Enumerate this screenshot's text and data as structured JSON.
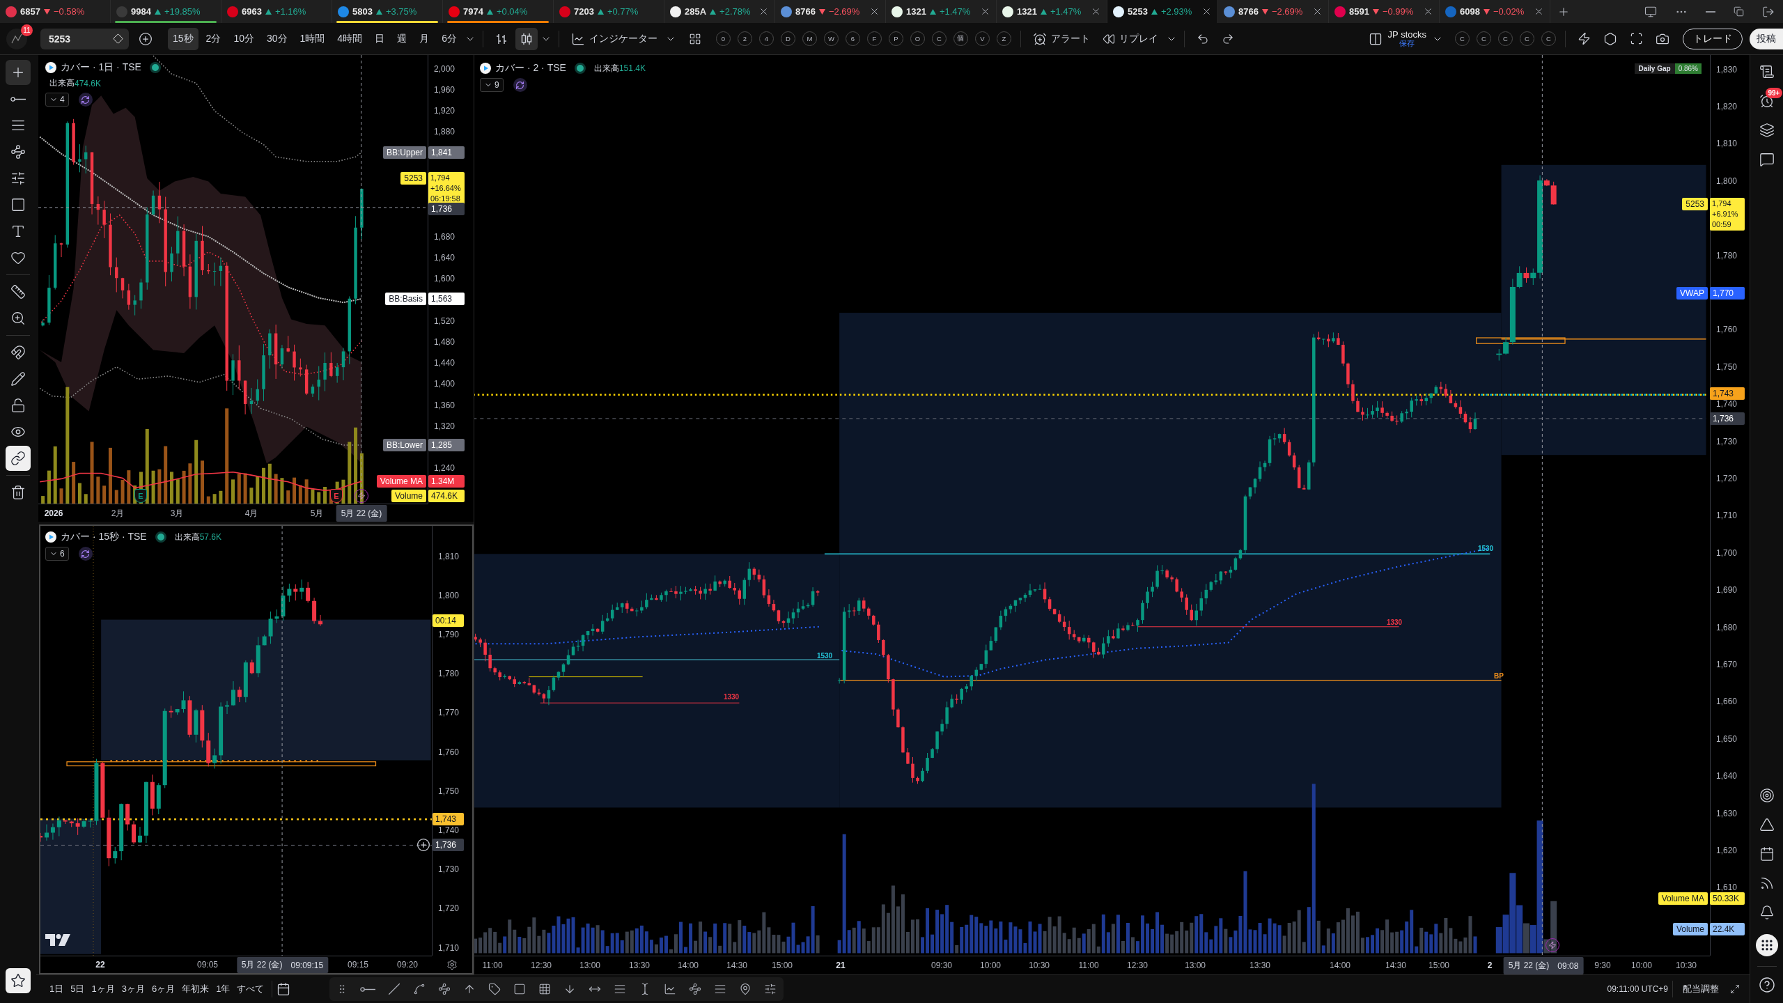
{
  "tabs": [
    {
      "symbol": "6857",
      "change": "−0.58%",
      "rising": false,
      "color": "#e0314b",
      "selected": false,
      "closable": false
    },
    {
      "symbol": "9984",
      "change": "+19.85%",
      "rising": true,
      "color": "#3a3a3a",
      "underline": {
        "color": "#4caf50"
      },
      "selected": false,
      "closable": false
    },
    {
      "symbol": "6963",
      "change": "+1.16%",
      "rising": true,
      "color": "#d7001a",
      "selected": false,
      "closable": false
    },
    {
      "symbol": "5803",
      "change": "+3.75%",
      "rising": true,
      "color": "#1e88e5",
      "underline": {
        "color": "#fdd835"
      },
      "selected": false,
      "closable": false
    },
    {
      "symbol": "7974",
      "change": "+0.04%",
      "rising": true,
      "color": "#e60012",
      "underline": {
        "color": "#f57c00"
      },
      "selected": false,
      "closable": false
    },
    {
      "symbol": "7203",
      "change": "+0.77%",
      "rising": true,
      "color": "#d7001a",
      "selected": false,
      "closable": false
    },
    {
      "symbol": "285A",
      "change": "+2.78%",
      "rising": true,
      "color": "#f2f2f2",
      "selected": false,
      "closable": true
    },
    {
      "symbol": "8766",
      "change": "−2.69%",
      "rising": false,
      "color": "#5b8fd6",
      "selected": false,
      "closable": true
    },
    {
      "symbol": "1321",
      "change": "+1.47%",
      "rising": true,
      "color": "#e8f5e9",
      "selected": false,
      "closable": true
    },
    {
      "symbol": "1321",
      "change": "+1.47%",
      "rising": true,
      "color": "#e8f5e9",
      "selected": false,
      "closable": true
    },
    {
      "symbol": "5253",
      "change": "+2.93%",
      "rising": true,
      "color": "#e3f2fd",
      "selected": true,
      "closable": true
    },
    {
      "symbol": "8766",
      "change": "−2.69%",
      "rising": false,
      "color": "#5b8fd6",
      "selected": false,
      "closable": true
    },
    {
      "symbol": "8591",
      "change": "−0.99%",
      "rising": false,
      "color": "#e0004d",
      "selected": false,
      "closable": true
    },
    {
      "symbol": "6098",
      "change": "−0.02%",
      "rising": false,
      "color": "#1565c0",
      "selected": false,
      "closable": true
    }
  ],
  "toolbar": {
    "notifications": "11",
    "symbol": "5253",
    "intervals": [
      {
        "label": "15秒",
        "selected": true
      },
      {
        "label": "2分",
        "selected": false
      },
      {
        "label": "10分",
        "selected": false
      },
      {
        "label": "30分",
        "selected": false
      },
      {
        "label": "1時間",
        "selected": false
      },
      {
        "label": "4時間",
        "selected": false
      },
      {
        "label": "日",
        "selected": false
      },
      {
        "label": "週",
        "selected": false
      },
      {
        "label": "月",
        "selected": false
      },
      {
        "label": "6分",
        "selected": false
      }
    ],
    "chart_styles": [
      {
        "kind": "bars",
        "selected": false
      },
      {
        "kind": "candles",
        "selected": true
      }
    ],
    "indicators": "インジケーター",
    "templates": [
      "0",
      "2",
      "4",
      "D",
      "M",
      "W",
      "6",
      "F",
      "P",
      "O",
      "C",
      "個",
      "V",
      "Z"
    ],
    "alert": "アラート",
    "replay": "リプレイ",
    "layout": {
      "name": "JP stocks",
      "status": "保存"
    },
    "layout_slots": [
      "C",
      "C",
      "C",
      "C",
      "C"
    ],
    "trade": "トレード",
    "publish": "投稿"
  },
  "tools": [
    {
      "kind": "crosshair",
      "selected": true
    },
    {
      "kind": "trend_line",
      "selected": false
    },
    {
      "kind": "channels",
      "selected": false
    },
    {
      "kind": "pattern",
      "selected": false
    },
    {
      "kind": "fib",
      "selected": false
    },
    {
      "kind": "shapes",
      "selected": false
    },
    {
      "kind": "text",
      "selected": false
    },
    {
      "kind": "favorites",
      "selected": false
    },
    {
      "kind": "ruler",
      "selected": false
    },
    {
      "kind": "zoom",
      "selected": false
    }
  ],
  "toggles": [
    {
      "kind": "magnet",
      "on": false
    },
    {
      "kind": "draw_lock",
      "on": false
    },
    {
      "kind": "lock",
      "on": false
    },
    {
      "kind": "visibility",
      "on": false
    },
    {
      "kind": "link",
      "on": true
    }
  ],
  "charts": [
    {
      "kind": "daily",
      "title": "カバー · 1日 · TSE",
      "live": true,
      "volume_label": "出来高",
      "volume": "474.6K",
      "collapsed_count": "4",
      "price_ticks": [
        "2,000",
        "1,960",
        "1,920",
        "1,880",
        "1,680",
        "1,640",
        "1,600",
        "1,520",
        "1,480",
        "1,440",
        "1,400",
        "1,360",
        "1,320",
        "1,240"
      ],
      "time_ticks": [
        {
          "label": "2026",
          "major": true
        },
        {
          "label": "2月",
          "major": false
        },
        {
          "label": "3月",
          "major": false
        },
        {
          "label": "4月",
          "major": false
        },
        {
          "label": "5月",
          "major": false
        }
      ],
      "time_cursor": {
        "date": "5月 22 (金)"
      },
      "labels": [
        {
          "kind": "tag",
          "name": "BB:Upper",
          "value": "1,841",
          "color": "#6a6d78"
        },
        {
          "kind": "last",
          "name": "5253",
          "value": "1,794",
          "change": "+16.64%",
          "countdown": "06:19:58",
          "color": "#ffeb3b"
        },
        {
          "kind": "crosshair",
          "value": "1,736",
          "color": "#363a45"
        },
        {
          "kind": "tag",
          "name": "BB:Basis",
          "value": "1,563",
          "color": "#ffffff"
        },
        {
          "kind": "tag",
          "name": "BB:Lower",
          "value": "1,285",
          "color": "#6a6d78"
        },
        {
          "kind": "tag",
          "name": "Volume MA",
          "value": "1.34M",
          "color": "#f23645"
        },
        {
          "kind": "tag",
          "name": "Volume",
          "value": "474.6K",
          "color": "#ffeb3b"
        }
      ],
      "events": [
        {
          "kind": "earnings",
          "label": "E",
          "color": "#089981"
        },
        {
          "kind": "earnings",
          "label": "E",
          "color": "#f23645"
        },
        {
          "kind": "flash"
        }
      ]
    },
    {
      "kind": "seconds",
      "title": "カバー · 15秒 · TSE",
      "live": true,
      "volume_label": "出来高",
      "volume": "57.6K",
      "collapsed_count": "6",
      "price_ticks": [
        "1,810",
        "1,800",
        "1,790",
        "1,780",
        "1,770",
        "1,760",
        "1,750",
        "1,740",
        "1,730",
        "1,720",
        "1,710"
      ],
      "time_ticks": [
        {
          "label": "22",
          "major": true
        },
        {
          "label": "09:05",
          "major": false
        },
        {
          "label": "09:15",
          "major": false
        },
        {
          "label": "09:20",
          "major": false
        }
      ],
      "time_cursor": {
        "date": "5月 22 (金)",
        "time": "09:09:15"
      },
      "labels": [
        {
          "kind": "value",
          "value": "00:14",
          "color": "#ffeb3b"
        },
        {
          "kind": "value",
          "value": "1,743",
          "color": "#f9c02e"
        },
        {
          "kind": "crosshair",
          "value": "1,736",
          "color": "#363a45",
          "with_add": true
        }
      ]
    },
    {
      "kind": "main",
      "title": "カバー · 2 · TSE",
      "live": true,
      "volume_label": "出来高",
      "volume": "151.4K",
      "collapsed_count": "9",
      "daily_gap": {
        "label": "Daily Gap",
        "value": "0.86%"
      },
      "price_ticks": [
        "1,830",
        "1,820",
        "1,810",
        "1,800",
        "1,780",
        "1,760",
        "1,750",
        "1,740",
        "1,730",
        "1,720",
        "1,710",
        "1,700",
        "1,690",
        "1,680",
        "1,670",
        "1,660",
        "1,650",
        "1,640",
        "1,630",
        "1,620",
        "1,610"
      ],
      "time_ticks": [
        {
          "label": "11:00",
          "major": false
        },
        {
          "label": "12:30",
          "major": false
        },
        {
          "label": "13:00",
          "major": false
        },
        {
          "label": "13:30",
          "major": false
        },
        {
          "label": "14:00",
          "major": false
        },
        {
          "label": "14:30",
          "major": false
        },
        {
          "label": "15:00",
          "major": false
        },
        {
          "label": "21",
          "major": true
        },
        {
          "label": "09:30",
          "major": false
        },
        {
          "label": "10:00",
          "major": false
        },
        {
          "label": "10:30",
          "major": false
        },
        {
          "label": "11:00",
          "major": false
        },
        {
          "label": "12:30",
          "major": false
        },
        {
          "label": "13:00",
          "major": false
        },
        {
          "label": "13:30",
          "major": false
        },
        {
          "label": "14:00",
          "major": false
        },
        {
          "label": "14:30",
          "major": false
        },
        {
          "label": "15:00",
          "major": false
        },
        {
          "label": "2",
          "major": true
        },
        {
          "label": "9:30",
          "major": false
        },
        {
          "label": "10:00",
          "major": false
        },
        {
          "label": "10:30",
          "major": false
        }
      ],
      "time_cursor": {
        "date": "5月 22 (金)",
        "time": "09:08"
      },
      "labels": [
        {
          "kind": "last",
          "name": "5253",
          "value": "1,794",
          "change": "+6.91%",
          "countdown": "00:59",
          "color": "#ffeb3b"
        },
        {
          "kind": "tag",
          "name": "VWAP",
          "value": "1,770",
          "color": "#2962ff"
        },
        {
          "kind": "value",
          "value": "1,743",
          "color": "#f7a21b"
        },
        {
          "kind": "crosshair",
          "value": "1,736",
          "color": "#363a45"
        },
        {
          "kind": "tag",
          "name": "Volume MA",
          "value": "50.33K",
          "color": "#ffeb3b"
        },
        {
          "kind": "tag",
          "name": "Volume",
          "value": "22.4K",
          "color": "#90bff9"
        }
      ],
      "line_labels": [
        {
          "text": "1530",
          "color": "#26c6da"
        },
        {
          "text": "1530",
          "color": "#26c6da"
        },
        {
          "text": "1330",
          "color": "#f23645"
        },
        {
          "text": "1330",
          "color": "#f23645"
        },
        {
          "text": "BP",
          "color": "#f7931a"
        }
      ],
      "events": [
        {
          "kind": "flash"
        }
      ]
    }
  ],
  "bottom_bar": {
    "ranges": [
      "1日",
      "5日",
      "1ヶ月",
      "3ヶ月",
      "6ヶ月",
      "年初来",
      "1年",
      "すべて"
    ],
    "clock": "09:11:00 UTC+9",
    "adjustment": "配当調整"
  },
  "right_sidebar": {
    "alerts_badge": "99+"
  }
}
